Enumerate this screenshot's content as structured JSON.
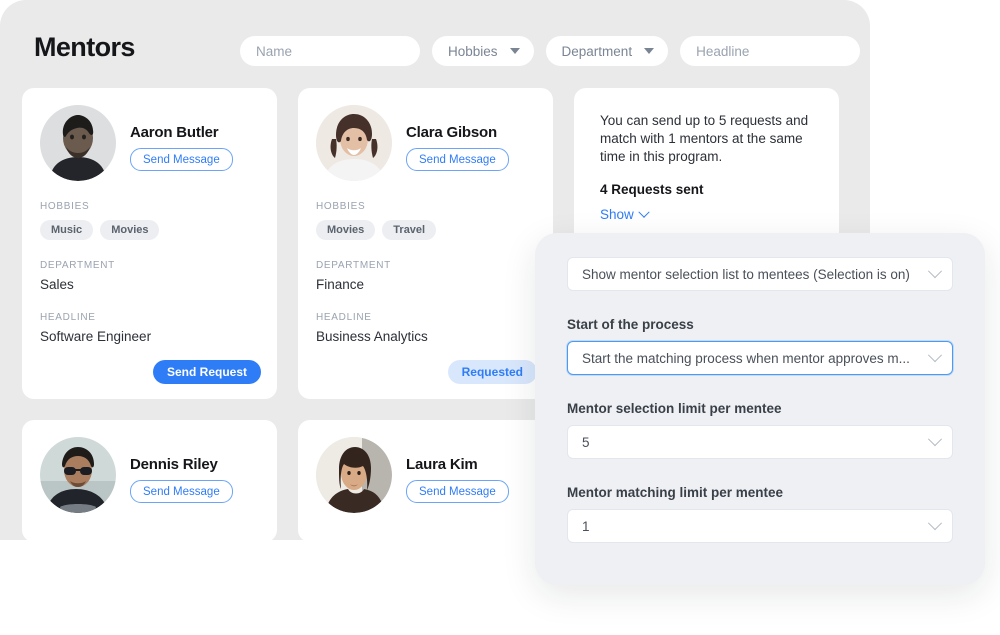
{
  "header": {
    "title": "Mentors"
  },
  "filters": [
    {
      "name": "name-filter",
      "type": "input",
      "placeholder": "Name"
    },
    {
      "name": "hobbies-filter",
      "type": "select",
      "label": "Hobbies"
    },
    {
      "name": "department-filter",
      "type": "select",
      "label": "Department"
    },
    {
      "name": "headline-filter",
      "type": "input",
      "placeholder": "Headline"
    }
  ],
  "card_labels": {
    "hobbies": "HOBBIES",
    "department": "DEPARTMENT",
    "headline": "HEADLINE",
    "send_message": "Send Message"
  },
  "mentors": [
    {
      "name": "Aaron Butler",
      "send_message": "Send Message",
      "hobbies": [
        "Music",
        "Movies"
      ],
      "department": "Sales",
      "headline": "Software Engineer",
      "action": "Send Request",
      "action_state": "available"
    },
    {
      "name": "Clara Gibson",
      "send_message": "Send Message",
      "hobbies": [
        "Movies",
        "Travel"
      ],
      "department": "Finance",
      "headline": "Business Analytics",
      "action": "Requested",
      "action_state": "requested"
    },
    {
      "name": "Dennis Riley",
      "send_message": "Send Message"
    },
    {
      "name": "Laura Kim",
      "send_message": "Send Message"
    }
  ],
  "info_card": {
    "text": "You can send up to 5 requests and match with 1 mentors at the same time in this program.",
    "count_text": "4 Requests sent",
    "show_link": "Show"
  },
  "settings": {
    "selection_visibility": "Show mentor selection list to mentees (Selection is on)",
    "start_of_process_label": "Start of the process",
    "start_of_process_value": "Start the matching process when mentor approves m...",
    "selection_limit_label": "Mentor selection limit per mentee",
    "selection_limit_value": "5",
    "matching_limit_label": "Mentor matching limit per mentee",
    "matching_limit_value": "1"
  },
  "colors": {
    "accent": "#2f7df6",
    "page_bg": "#eaeaea",
    "panel_bg": "#eef0f4",
    "card_bg": "#ffffff",
    "tag_bg": "#eceef1",
    "requested_bg": "#d9e7fd"
  }
}
